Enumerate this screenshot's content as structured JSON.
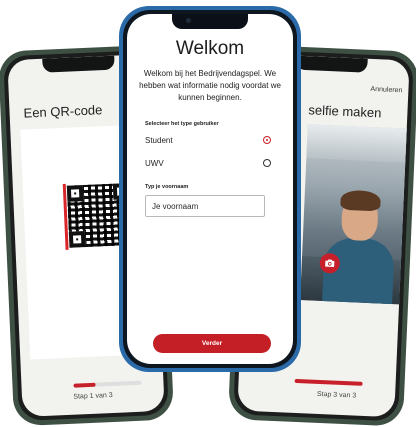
{
  "left_screen": {
    "title": "Een QR-code",
    "step_label": "Stap 1 van 3",
    "progress": 0.33
  },
  "right_screen": {
    "cancel_label": "Annuleren",
    "title": "selfie maken",
    "step_label": "Stap 3 van 3",
    "progress": 1.0,
    "camera_icon": "camera-icon"
  },
  "center_screen": {
    "title": "Welkom",
    "intro": "Welkom bij het Bedrijvendagspel. We hebben wat informatie nodig voordat we kunnen beginnen.",
    "user_type_label": "Selecteer het type gebruiker",
    "options": [
      {
        "label": "Student",
        "selected": true
      },
      {
        "label": "UWV",
        "selected": false
      }
    ],
    "first_name_label": "Typ je voornaam",
    "first_name_placeholder": "Je voornaam",
    "first_name_value": "",
    "continue_label": "Verder"
  },
  "colors": {
    "accent": "#c41f26",
    "center_frame": "#2a6aa8",
    "side_frame": "#3e5044"
  }
}
